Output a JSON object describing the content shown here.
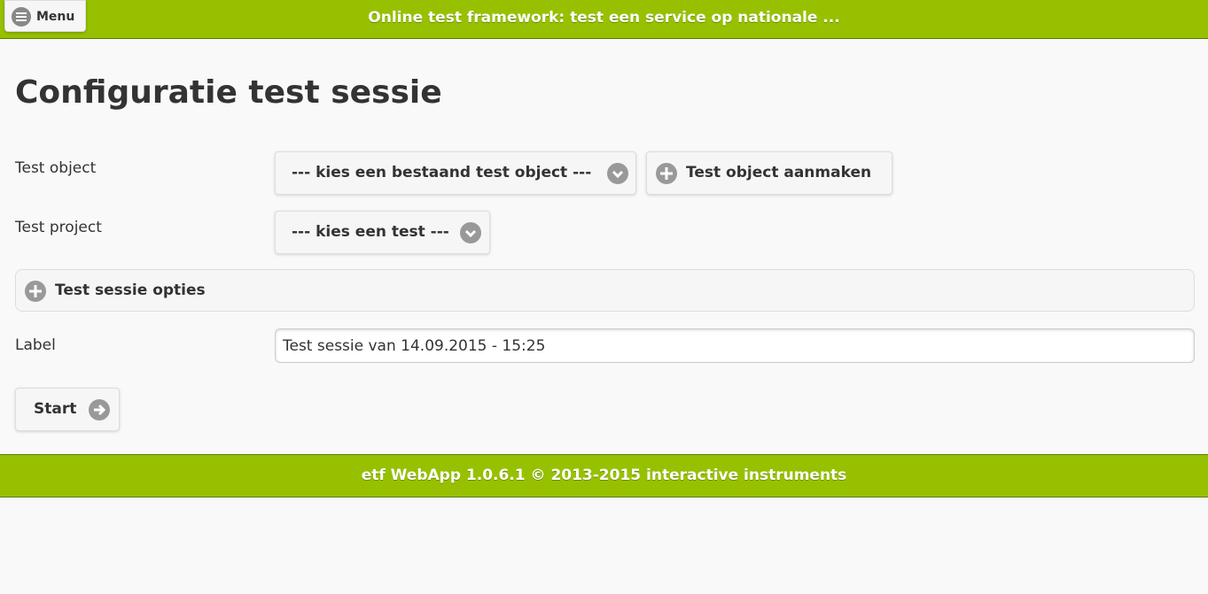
{
  "header": {
    "title": "Online test framework: test een service op nationale ...",
    "menu_label": "Menu",
    "menu_icon": "hamburger-icon"
  },
  "page": {
    "title": "Configuratie test sessie"
  },
  "form": {
    "test_object": {
      "label": "Test object",
      "select_value": "--- kies een bestaand test object ---",
      "create_button": "Test object aanmaken"
    },
    "test_project": {
      "label": "Test project",
      "select_value": "--- kies een test ---"
    },
    "options": {
      "label": "Test sessie opties",
      "icon": "plus-icon"
    },
    "label_field": {
      "label": "Label",
      "value": "Test sessie van 14.09.2015 - 15:25"
    },
    "start_button": "Start"
  },
  "footer": {
    "text": "etf WebApp 1.0.6.1 © 2013-2015 interactive instruments"
  },
  "colors": {
    "accent": "#97c100",
    "background": "#f9f9f9",
    "icon_gray": "#999999"
  }
}
